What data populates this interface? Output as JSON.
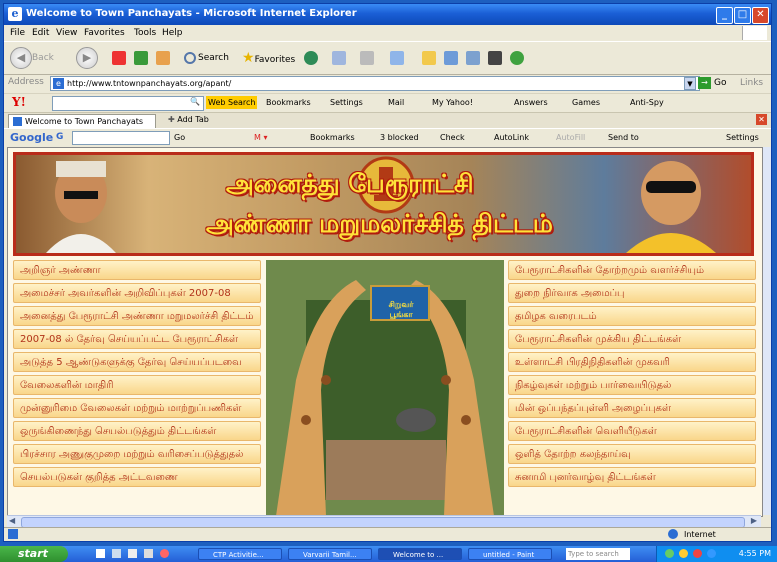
{
  "window": {
    "title": "Welcome to Town Panchayats - Microsoft Internet Explorer"
  },
  "menu": [
    "File",
    "Edit",
    "View",
    "Favorites",
    "Tools",
    "Help"
  ],
  "toolbar": {
    "back": "Back",
    "search": "Search",
    "favorites": "Favorites"
  },
  "address": {
    "label": "Address",
    "url": "http://www.tntownpanchayats.org/apant/",
    "go": "Go",
    "links": "Links"
  },
  "yahoo": {
    "logo": "Y!",
    "web_search": "Web Search",
    "bookmarks": "Bookmarks",
    "settings": "Settings",
    "mail": "Mail",
    "my_yahoo": "My Yahoo!",
    "answers": "Answers",
    "games": "Games",
    "anti_spy": "Anti-Spy"
  },
  "tabs": {
    "current": "Welcome to Town Panchayats",
    "add": "Add Tab"
  },
  "google": {
    "logo": "Google",
    "g": "G",
    "go": "Go",
    "bookmarks": "Bookmarks",
    "blocked": "3 blocked",
    "check": "Check",
    "autolink": "AutoLink",
    "autofill": "AutoFill",
    "sendto": "Send to",
    "settings": "Settings"
  },
  "banner": {
    "line1": "அனைத்து பேரூராட்சி",
    "line2": "அண்ணா மறுமலர்ச்சித் திட்டம்"
  },
  "left_menu": [
    "அறிஞர் அண்ணா",
    "அமைச்சர் அவர்களின் அறிவிப்புகள் 2007-08",
    "அனைத்து பேரூராட்சி அண்ணா மறுமலர்ச்சி திட்டம்",
    "2007-08 ல் தேர்வு செய்யப்பட்ட பேரூராட்சிகள்",
    "அடுத்த 5 ஆண்டுகளுக்கு தேர்வு செய்யப்படவை",
    "வேலைகளின் மாதிரி",
    "முன்னுரிமை வேலைகள் மற்றும் மாற்றுப்பணிகள்",
    "ஒருங்கிணைந்து செயல்படுத்தும் திட்டங்கள்",
    "பிரச்சார அணுகுமுறை மற்றும் வரிசைப்படுத்துதல்",
    "செயல்படுகள் குறித்த அட்டவணை"
  ],
  "right_menu": [
    "பேரூராட்சிகளின் தோற்றமும் வளர்ச்சியும்",
    "துறை நிர்வாக அமைப்பு",
    "தமிழக வரைபடம்",
    "பேரூராட்சிகளின் முக்கிய திட்டங்கள்",
    "உள்ளாட்சி பிரதிநிதிகளின் முகவரி",
    "நிகழ்வுகள் மற்றும் பார்வையிடுதல்",
    "மின் ஒப்பந்தப்புள்ளி அழைப்புகள்",
    "பேரூராட்சிகளின் வெளியீடுகள்",
    "ஒளித் தோற்ற கலந்தாய்வு",
    "சுனாமி புனர்வாழ்வு திட்டங்கள்"
  ],
  "photo": {
    "sign": "சிறுவர் பூங்கா"
  },
  "status": {
    "zone": "Internet"
  },
  "taskbar": {
    "start": "start",
    "items": [
      {
        "label": "CTP Activitie..."
      },
      {
        "label": "Varvarii Tamil..."
      },
      {
        "label": "Welcome to ..."
      },
      {
        "label": "untitled - Paint"
      }
    ],
    "search_placeholder": "Type to search",
    "clock": "4:55 PM"
  }
}
